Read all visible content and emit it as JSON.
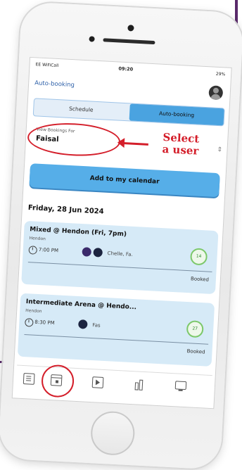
{
  "status_bar": {
    "carrier": "EE WiFiCall",
    "time": "09:20",
    "battery": "29%"
  },
  "app": {
    "title": "Auto-booking"
  },
  "segmented": {
    "schedule": "Schedule",
    "auto_booking": "Auto-booking"
  },
  "view_bookings": {
    "label": "View Bookings For",
    "value": "Faisal"
  },
  "annotation": {
    "line1": "Select",
    "line2": "a user"
  },
  "calendar_button": "Add to my calendar",
  "date_heading": "Friday, 28 Jun 2024",
  "bookings": [
    {
      "title": "Mixed @ Hendon (Fri, 7pm)",
      "venue": "Hendon",
      "time": "7:00 PM",
      "attendees": "Chelle, Fa.",
      "spots": "14",
      "status": "Booked"
    },
    {
      "title": "Intermediate Arena @ Hendo...",
      "venue": "Hendon",
      "time": "8:30 PM",
      "attendees": "Fas",
      "spots": "27",
      "status": "Booked"
    }
  ],
  "colors": {
    "accent": "#4aa3e0",
    "card": "#d6eaf7",
    "annotation": "#d41e2a",
    "title": "#2c5fa8"
  },
  "icons": [
    "document-icon",
    "calendar-icon",
    "play-icon",
    "stats-icon",
    "monitor-icon"
  ]
}
